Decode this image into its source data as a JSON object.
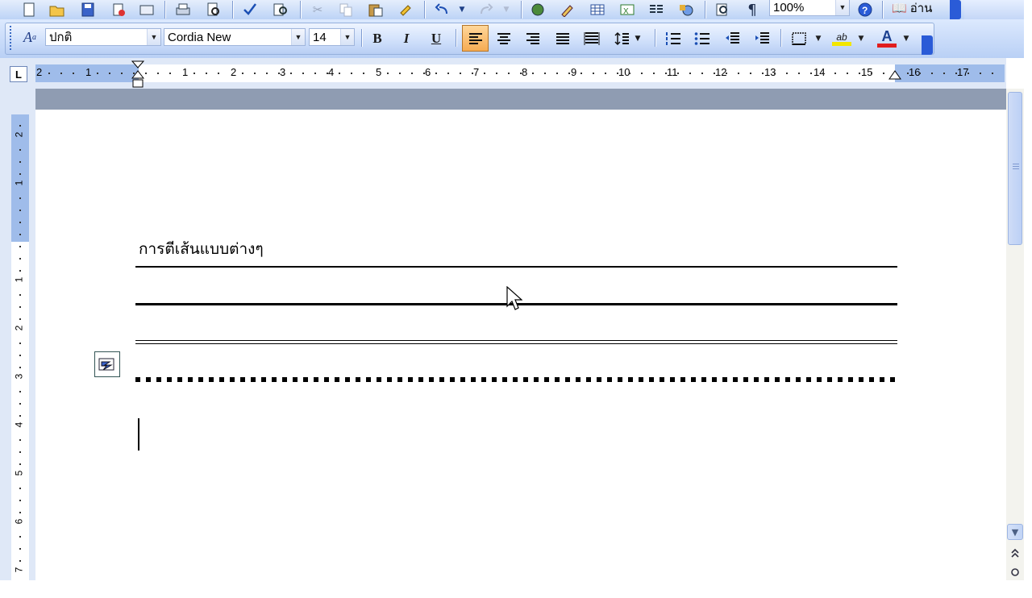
{
  "standard_toolbar": {
    "zoom_value": "100%",
    "read_button_label": "อ่าน",
    "icons": [
      "new-icon",
      "open-icon",
      "save-icon",
      "permission-icon",
      "print-icon",
      "print-preview-icon",
      "spelling-icon",
      "research-icon",
      "cut-icon",
      "copy-icon",
      "paste-icon",
      "format-painter-icon",
      "undo-icon",
      "redo-icon",
      "hyperlink-icon",
      "tables-borders-icon",
      "insert-table-icon",
      "excel-icon",
      "columns-icon",
      "drawing-icon",
      "document-map-icon",
      "show-hide-icon",
      "help-icon"
    ]
  },
  "formatting_toolbar": {
    "style": "ปกติ",
    "font": "Cordia New",
    "size": "14",
    "bold": "B",
    "italic": "I",
    "underline": "U",
    "font_color_glyph": "A",
    "highlight_glyph": "ab",
    "styles_glyph": "A",
    "active_alignment": "align-left",
    "highlight_color": "#f3e600",
    "font_color": "#e11d1d"
  },
  "ruler": {
    "tab_selector": "L",
    "h_labels": [
      "2",
      "1",
      "1",
      "2",
      "3",
      "4",
      "5",
      "6",
      "7",
      "8",
      "9",
      "10",
      "11",
      "12",
      "13",
      "14",
      "15",
      "16",
      "17"
    ],
    "v_labels": [
      "2",
      "1",
      "1",
      "2",
      "3",
      "4",
      "5",
      "6",
      "7"
    ]
  },
  "document": {
    "heading": "การตีเส้นแบบต่างๆ",
    "lines": [
      "thin",
      "thick",
      "double",
      "dotted"
    ]
  }
}
